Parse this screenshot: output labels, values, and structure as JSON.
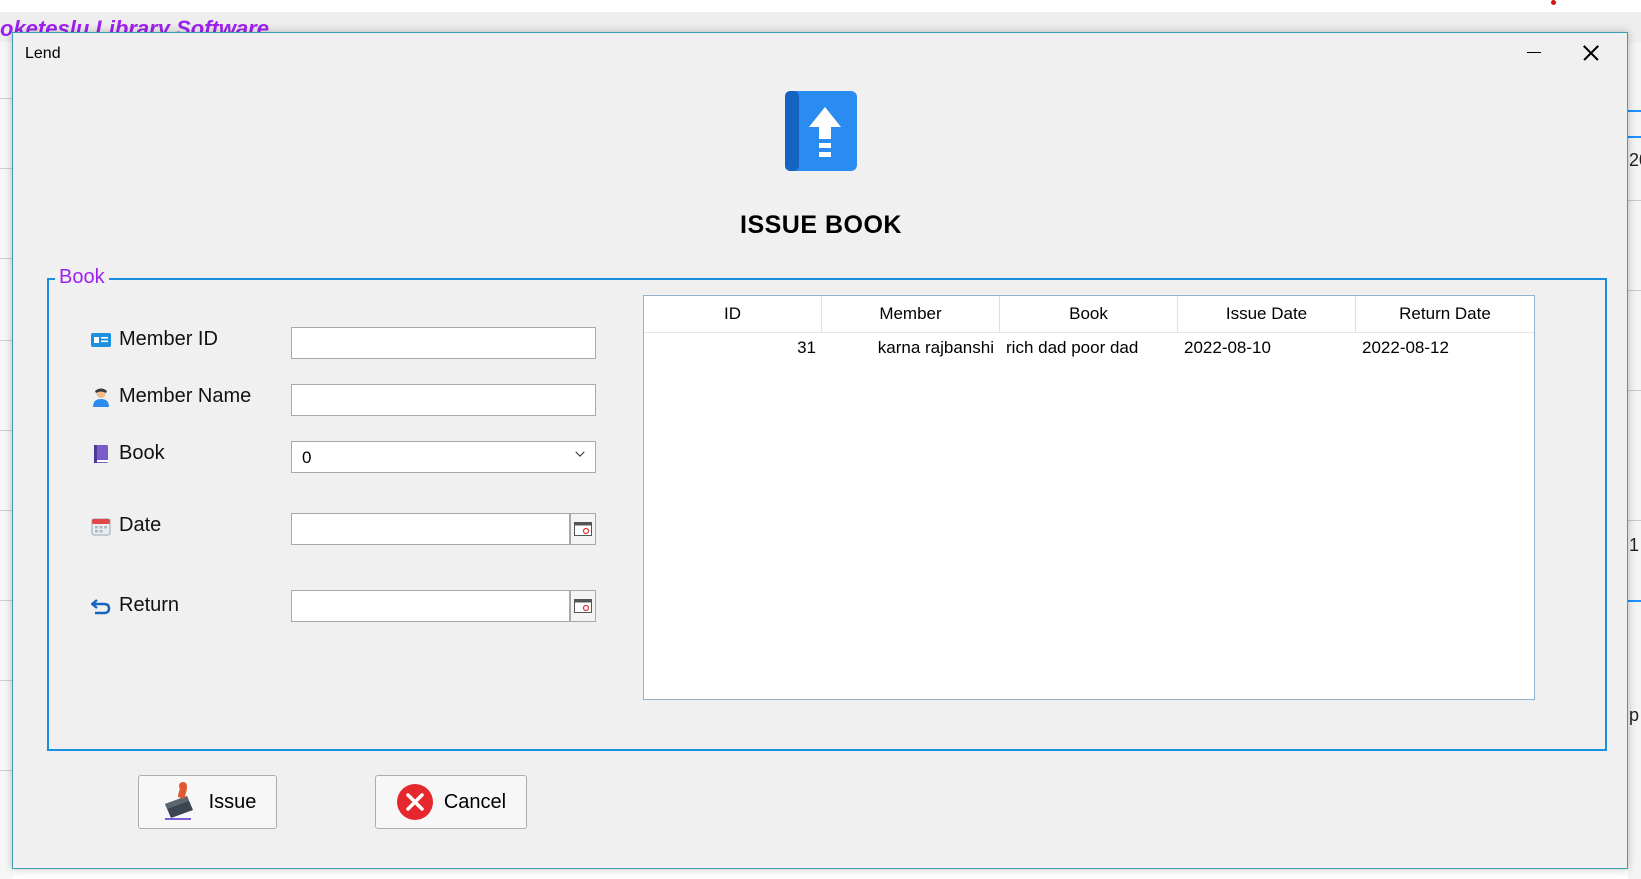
{
  "background": {
    "app_title": "oketeslu Library Software",
    "right_fragments": [
      "20",
      "1",
      "p"
    ]
  },
  "window": {
    "title": "Lend",
    "minimize_icon": "minimize-icon",
    "close_icon": "close-icon"
  },
  "header": {
    "icon": "book-upload-icon",
    "title": "ISSUE BOOK"
  },
  "group": {
    "legend": "Book",
    "fields": {
      "member_id": {
        "label": "Member ID",
        "icon": "id-card-icon",
        "value": ""
      },
      "member_name": {
        "label": "Member Name",
        "icon": "user-icon",
        "value": ""
      },
      "book": {
        "label": "Book",
        "icon": "book-icon",
        "value": "0"
      },
      "date": {
        "label": "Date",
        "icon": "calendar-icon",
        "value": ""
      },
      "return": {
        "label": "Return",
        "icon": "return-arrow-icon",
        "value": ""
      }
    }
  },
  "table": {
    "columns": [
      "ID",
      "Member",
      "Book",
      "Issue Date",
      "Return Date"
    ],
    "rows": [
      [
        "31",
        "karna rajbanshi",
        "rich dad poor dad",
        "2022-08-10",
        "2022-08-12"
      ]
    ]
  },
  "buttons": {
    "issue": {
      "label": "Issue",
      "icon": "stamp-icon"
    },
    "cancel": {
      "label": "Cancel",
      "icon": "cancel-x-icon"
    }
  },
  "colors": {
    "accent_border": "#1a8fe0",
    "legend": "#a020f0",
    "cancel_red": "#e5282e"
  }
}
